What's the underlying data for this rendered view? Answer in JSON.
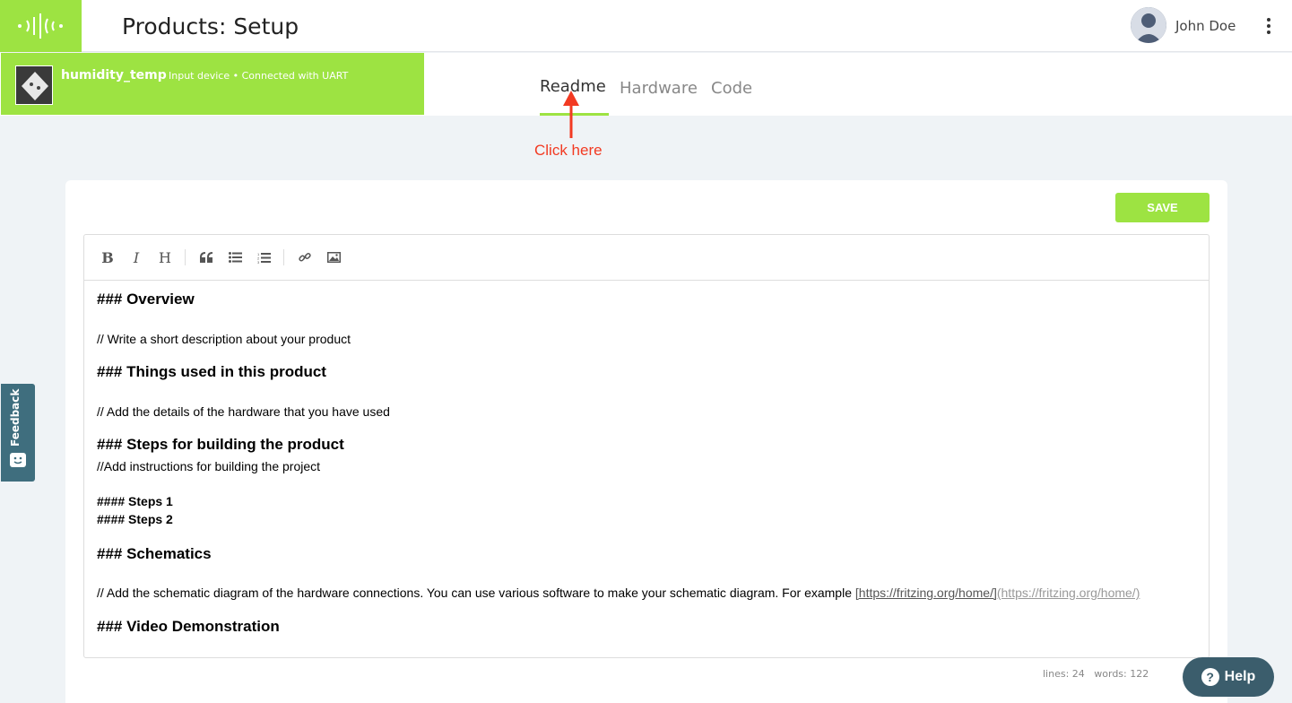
{
  "header": {
    "title": "Products: Setup",
    "user_name": "John Doe",
    "logo_icon": "sound-waves-logo-icon",
    "menu_icon": "kebab-menu-icon"
  },
  "device": {
    "name": "humidity_temp",
    "meta": "Input device • Connected with UART"
  },
  "tabs": [
    {
      "label": "Readme",
      "active": true
    },
    {
      "label": "Hardware",
      "active": false
    },
    {
      "label": "Code",
      "active": false
    }
  ],
  "annotation": {
    "text": "Click here"
  },
  "editor": {
    "save_label": "SAVE",
    "toolbar": [
      "B",
      "I",
      "H"
    ],
    "content": {
      "h_overview": "### Overview",
      "p_overview": "// Write a short description about your product",
      "h_things": "### Things used in this product",
      "p_things": "// Add the details of the hardware that you have used",
      "h_steps": "### Steps for building the product",
      "p_steps": "//Add instructions for building the project",
      "h4_steps1": "#### Steps 1",
      "h4_steps2": "#### Steps 2",
      "h_schematics": "### Schematics",
      "p_schematics": "// Add the schematic diagram of the hardware connections. You can use various software to make your schematic diagram. For example ",
      "link_text": "[https://fritzing.org/home/]",
      "link_url": "(https://fritzing.org/home/)",
      "h_video": "### Video Demonstration"
    },
    "stats": "lines: 24   words: 122"
  },
  "feedback": {
    "label": "Feedback"
  },
  "help": {
    "label": "Help",
    "icon": "?"
  },
  "colors": {
    "brand_green": "#9de342",
    "annotation_red": "#f23a22",
    "help_bg": "#3b5d6c",
    "feedback_bg": "#3f6e7e"
  }
}
